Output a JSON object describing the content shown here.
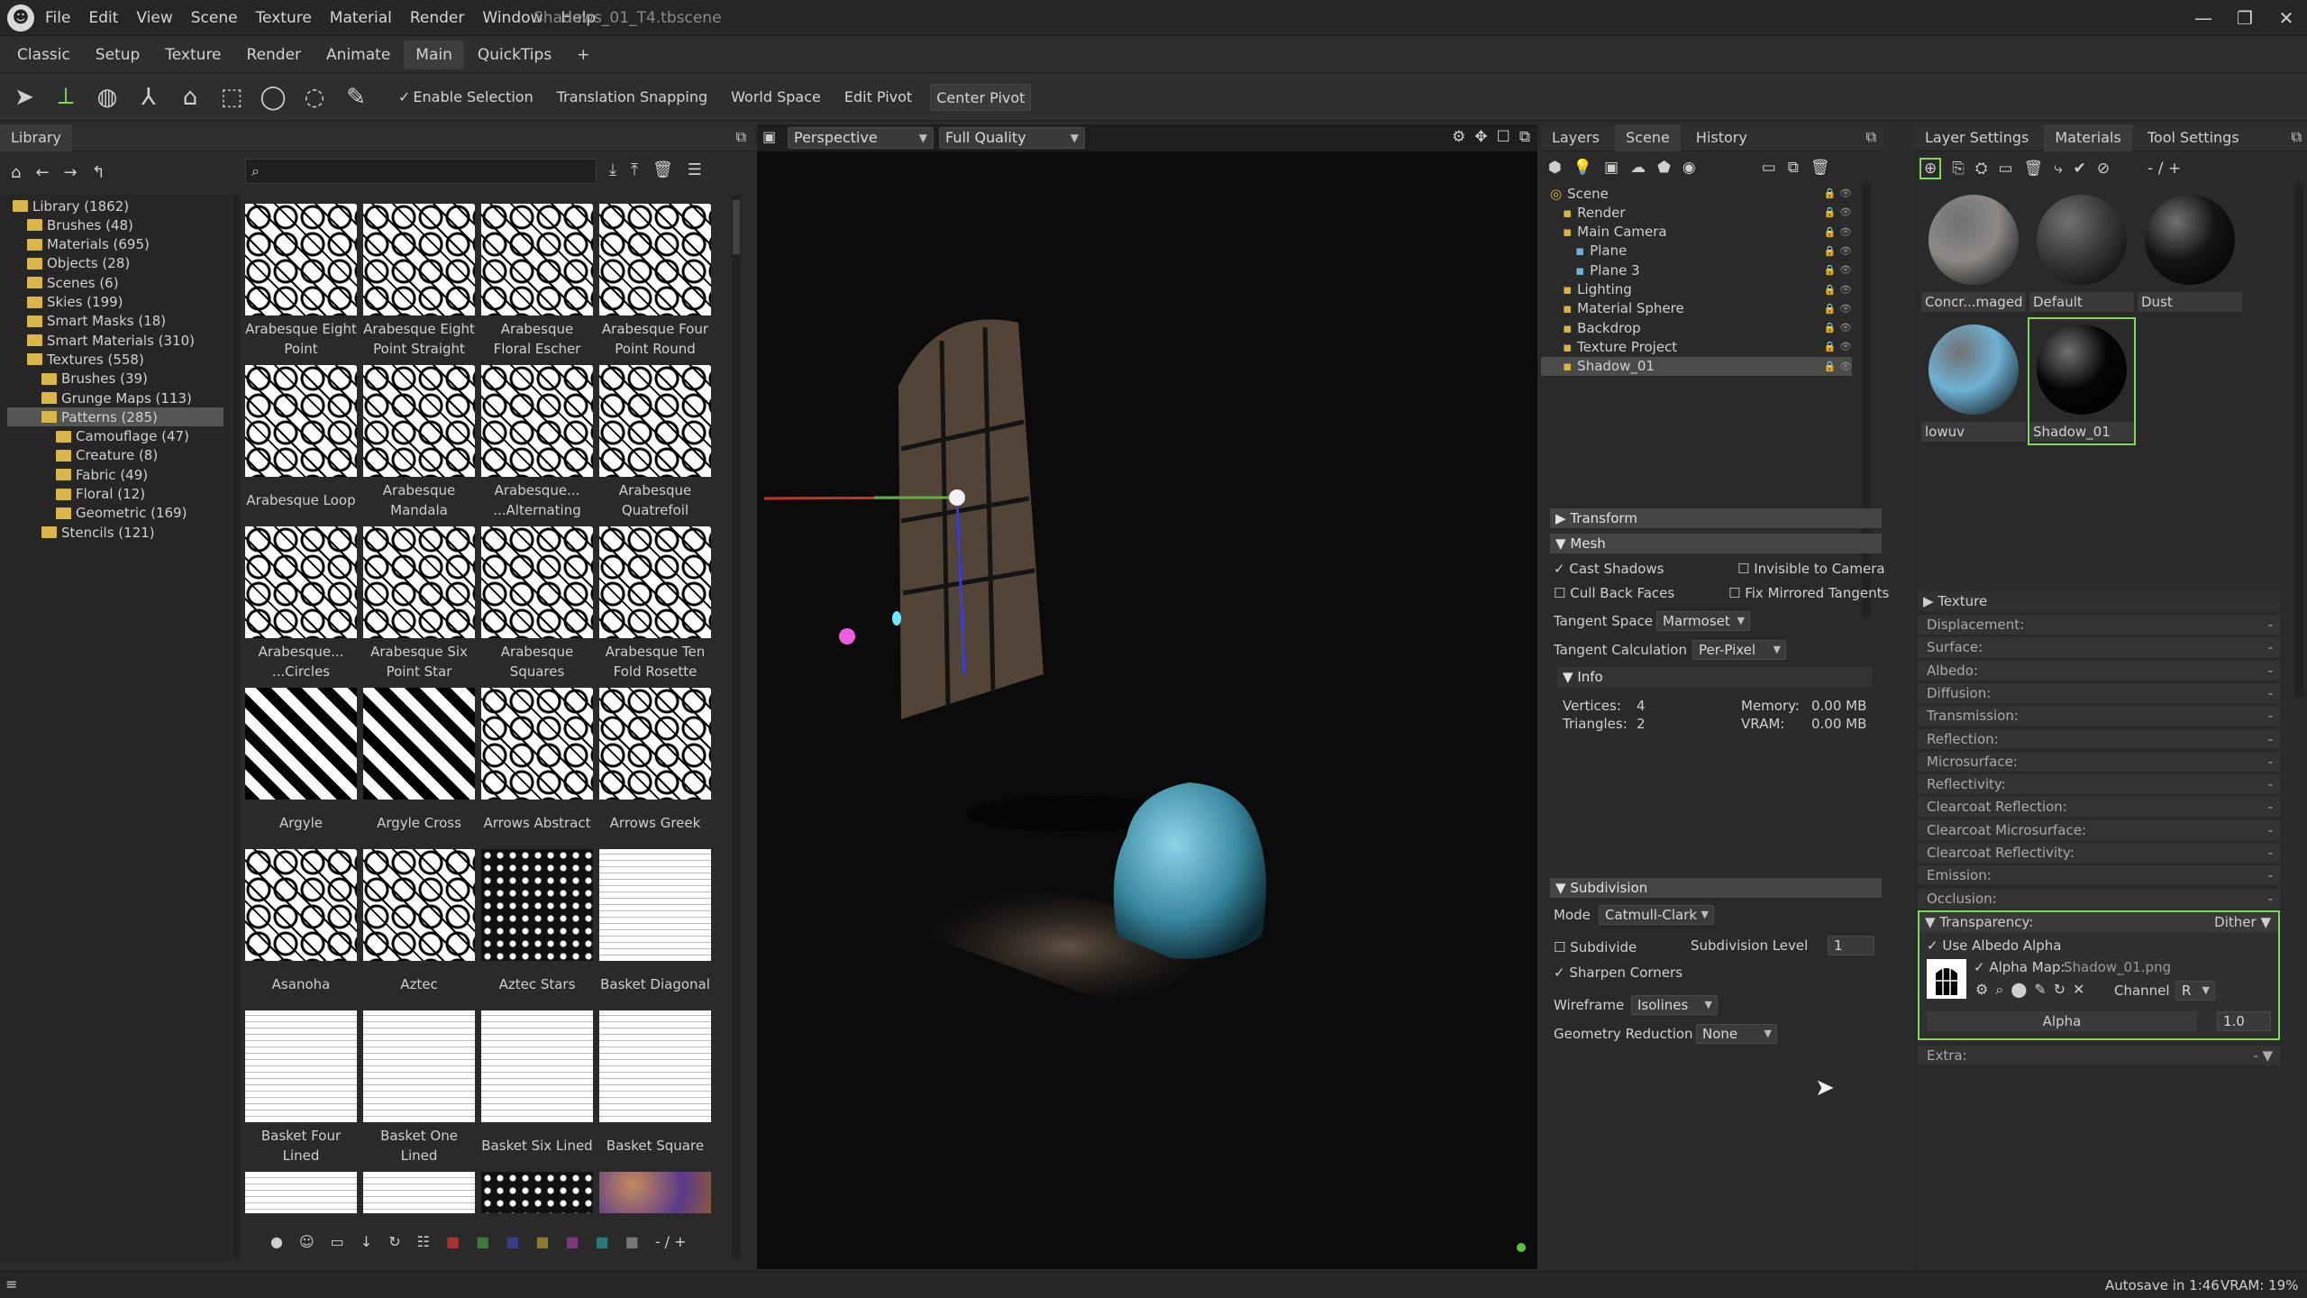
{
  "app": {
    "menus": [
      "File",
      "Edit",
      "View",
      "Scene",
      "Texture",
      "Material",
      "Render",
      "Window",
      "Help"
    ],
    "doc_title": "Shadows_01_T4.tbscene",
    "window_buttons": [
      "—",
      "❐",
      "✕"
    ]
  },
  "workspace_tabs": [
    "Classic",
    "Setup",
    "Texture",
    "Render",
    "Animate",
    "Main",
    "QuickTips",
    "+"
  ],
  "active_workspace": "Main",
  "toolbar": {
    "enable_selection": "Enable Selection",
    "translation_snapping": "Translation Snapping",
    "world_space": "World Space",
    "edit_pivot": "Edit Pivot",
    "center_pivot": "Center Pivot"
  },
  "library": {
    "title": "Library",
    "tree": [
      {
        "label": "Library (1862)",
        "depth": 0
      },
      {
        "label": "Brushes (48)",
        "depth": 1
      },
      {
        "label": "Materials (695)",
        "depth": 1
      },
      {
        "label": "Objects (28)",
        "depth": 1
      },
      {
        "label": "Scenes (6)",
        "depth": 1
      },
      {
        "label": "Skies (199)",
        "depth": 1
      },
      {
        "label": "Smart Masks (18)",
        "depth": 1
      },
      {
        "label": "Smart Materials (310)",
        "depth": 1
      },
      {
        "label": "Textures (558)",
        "depth": 1
      },
      {
        "label": "Brushes (39)",
        "depth": 2
      },
      {
        "label": "Grunge Maps (113)",
        "depth": 2
      },
      {
        "label": "Patterns (285)",
        "depth": 2,
        "selected": true
      },
      {
        "label": "Camouflage (47)",
        "depth": 3
      },
      {
        "label": "Creature (8)",
        "depth": 3
      },
      {
        "label": "Fabric (49)",
        "depth": 3
      },
      {
        "label": "Floral (12)",
        "depth": 3
      },
      {
        "label": "Geometric (169)",
        "depth": 3
      },
      {
        "label": "Stencils (121)",
        "depth": 2
      }
    ],
    "items": [
      {
        "line1": "Arabesque Eight",
        "line2": "Point"
      },
      {
        "line1": "Arabesque Eight",
        "line2": "Point Straight"
      },
      {
        "line1": "Arabesque",
        "line2": "Floral Escher"
      },
      {
        "line1": "Arabesque Four",
        "line2": "Point Round"
      },
      {
        "line1": "Arabesque Loop",
        "line2": ""
      },
      {
        "line1": "Arabesque",
        "line2": "Mandala"
      },
      {
        "line1": "Arabesque...",
        "line2": "...Alternating"
      },
      {
        "line1": "Arabesque",
        "line2": "Quatrefoil"
      },
      {
        "line1": "Arabesque...",
        "line2": "...Circles"
      },
      {
        "line1": "Arabesque Six",
        "line2": "Point Star"
      },
      {
        "line1": "Arabesque",
        "line2": "Squares"
      },
      {
        "line1": "Arabesque Ten",
        "line2": "Fold Rosette"
      },
      {
        "line1": "Argyle",
        "line2": ""
      },
      {
        "line1": "Argyle Cross",
        "line2": ""
      },
      {
        "line1": "Arrows Abstract",
        "line2": ""
      },
      {
        "line1": "Arrows Greek",
        "line2": ""
      },
      {
        "line1": "Asanoha",
        "line2": ""
      },
      {
        "line1": "Aztec",
        "line2": ""
      },
      {
        "line1": "Aztec Stars",
        "line2": ""
      },
      {
        "line1": "Basket Diagonal",
        "line2": ""
      },
      {
        "line1": "Basket Four",
        "line2": "Lined"
      },
      {
        "line1": "Basket One",
        "line2": "Lined"
      },
      {
        "line1": "Basket Six Lined",
        "line2": ""
      },
      {
        "line1": "Basket Square",
        "line2": ""
      },
      {
        "line1": "",
        "line2": ""
      },
      {
        "line1": "",
        "line2": ""
      },
      {
        "line1": "",
        "line2": ""
      },
      {
        "line1": "",
        "line2": ""
      }
    ],
    "footer_page": "- / +"
  },
  "viewport": {
    "camera": "Perspective",
    "quality": "Full Quality"
  },
  "scene": {
    "tabs": [
      "Layers",
      "Scene",
      "History"
    ],
    "active_tab": "Scene",
    "tree": [
      {
        "label": "Scene",
        "depth": 0
      },
      {
        "label": "Render",
        "depth": 1
      },
      {
        "label": "Main Camera",
        "depth": 1
      },
      {
        "label": "Plane",
        "depth": 2
      },
      {
        "label": "Plane 3",
        "depth": 2
      },
      {
        "label": "Lighting",
        "depth": 1
      },
      {
        "label": "Material Sphere",
        "depth": 1
      },
      {
        "label": "Backdrop",
        "depth": 1
      },
      {
        "label": "Texture Project",
        "depth": 1
      },
      {
        "label": "Shadow_01",
        "depth": 1,
        "selected": true
      }
    ],
    "sections": {
      "transform": "Transform",
      "mesh": "Mesh",
      "info": "Info",
      "subdivision": "Subdivision"
    },
    "mesh": {
      "cast_shadows": "Cast Shadows",
      "invisible_to_camera": "Invisible to Camera",
      "cull_back_faces": "Cull Back Faces",
      "fix_mirrored_tangents": "Fix Mirrored Tangents",
      "tangent_space_label": "Tangent Space",
      "tangent_space_value": "Marmoset",
      "tangent_calc_label": "Tangent Calculation",
      "tangent_calc_value": "Per-Pixel"
    },
    "info": {
      "vertices_label": "Vertices:",
      "vertices": "4",
      "triangles_label": "Triangles:",
      "triangles": "2",
      "memory_label": "Memory:",
      "memory": "0.00 MB",
      "vram_label": "VRAM:",
      "vram": "0.00 MB"
    },
    "subdivision": {
      "mode_label": "Mode",
      "mode_value": "Catmull-Clark",
      "subdivide": "Subdivide",
      "level_label": "Subdivision Level",
      "level_value": "1",
      "sharpen_corners": "Sharpen Corners",
      "wireframe_label": "Wireframe",
      "wireframe_value": "Isolines",
      "geo_reduction_label": "Geometry Reduction",
      "geo_reduction_value": "None"
    }
  },
  "materials_panel": {
    "tabs": [
      "Layer Settings",
      "Materials",
      "Tool Settings"
    ],
    "active_tab": "Materials",
    "page": "- / +",
    "materials": [
      {
        "name": "Concr...maged",
        "color": "#8d8a86"
      },
      {
        "name": "Default",
        "color": "#3a3a3a"
      },
      {
        "name": "Dust",
        "color": "#151515"
      },
      {
        "name": "lowuv",
        "color": "#6fb2d4"
      },
      {
        "name": "Shadow_01",
        "color": "#050505",
        "selected": true
      }
    ],
    "texture_section": "Texture",
    "rows": [
      "Displacement:",
      "Surface:",
      "Albedo:",
      "Diffusion:",
      "Transmission:",
      "Reflection:",
      "Microsurface:",
      "Reflectivity:",
      "Clearcoat Reflection:",
      "Clearcoat Microsurface:",
      "Clearcoat Reflectivity:",
      "Emission:",
      "Occlusion:"
    ],
    "row_value": "-",
    "transparency": {
      "label": "Transparency:",
      "mode": "Dither",
      "use_albedo_alpha": "Use Albedo Alpha",
      "alpha_map_label": "Alpha Map:",
      "alpha_map_file": "Shadow_01.png",
      "channel_label": "Channel",
      "channel_value": "R",
      "alpha_label": "Alpha",
      "alpha_value": "1.0"
    },
    "extra": "Extra:"
  },
  "status": {
    "autosave": "Autosave in 1:46",
    "vram": "VRAM: 19%"
  },
  "colors": {
    "accent_green": "#7ed957",
    "selection_bg": "#555555",
    "folder": "#d9b54a"
  }
}
